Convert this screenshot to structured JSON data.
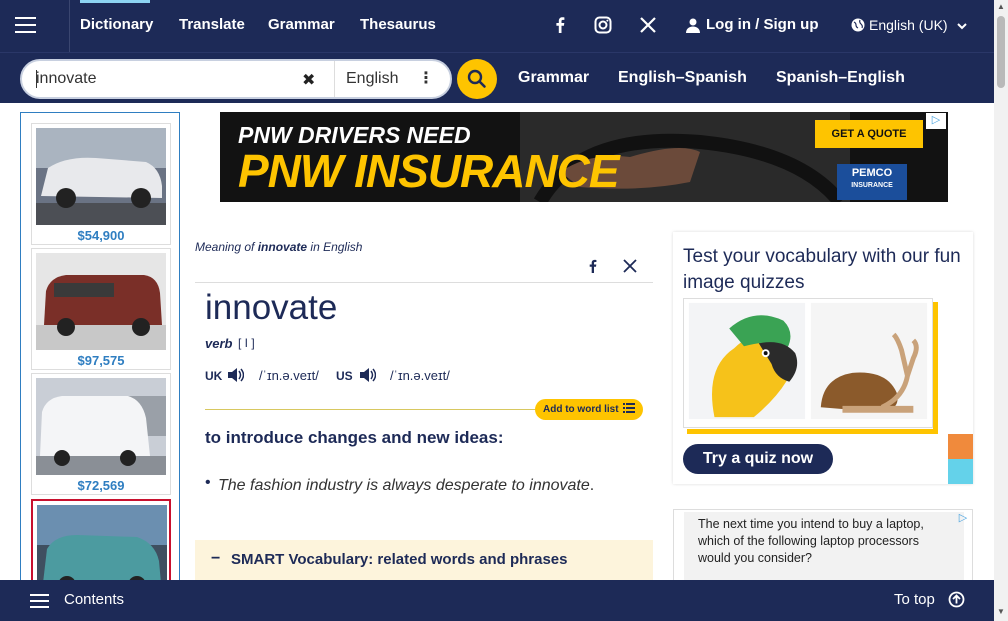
{
  "topnav": {
    "links": [
      "Dictionary",
      "Translate",
      "Grammar",
      "Thesaurus"
    ],
    "login": "Log in / Sign up",
    "language": "English (UK)"
  },
  "search": {
    "query": "innovate",
    "dictionary": "English"
  },
  "searchnav": {
    "links": [
      "Grammar",
      "English–Spanish",
      "Spanish–English"
    ]
  },
  "cars": [
    {
      "price": "$54,900"
    },
    {
      "price": "$97,575"
    },
    {
      "price": "$72,569"
    }
  ],
  "banner": {
    "line1": "PNW DRIVERS NEED",
    "line2": "PNW INSURANCE",
    "cta": "GET A QUOTE",
    "brand": "PEMCO",
    "brand_sub": "INSURANCE"
  },
  "entry": {
    "meaning_prefix": "Meaning of ",
    "meaning_word": "innovate",
    "meaning_suffix": " in English",
    "headword": "innovate",
    "pos": "verb",
    "grammar": "[ I ]",
    "uk_label": "UK",
    "uk_ipa": "/ˈɪn.ə.veɪt/",
    "us_label": "US",
    "us_ipa": "/ˈɪn.ə.veɪt/",
    "add_to_list": "Add to word list",
    "definition": "to introduce changes and new ideas:",
    "example_main": "The fashion industry is always desperate to innovate",
    "example_end": ".",
    "smart_vocab": "SMART Vocabulary: related words and phrases"
  },
  "quiz": {
    "title": "Test your vocabulary with our fun image quizzes",
    "button": "Try a quiz now"
  },
  "ad2": {
    "text": "The next time you intend to buy a laptop, which of the following laptop processors would you consider?"
  },
  "footer": {
    "contents": "Contents",
    "totop": "To top"
  },
  "colors": {
    "navy": "#1d2a57",
    "yellow": "#fec400",
    "price_blue": "#2f7ec1"
  }
}
